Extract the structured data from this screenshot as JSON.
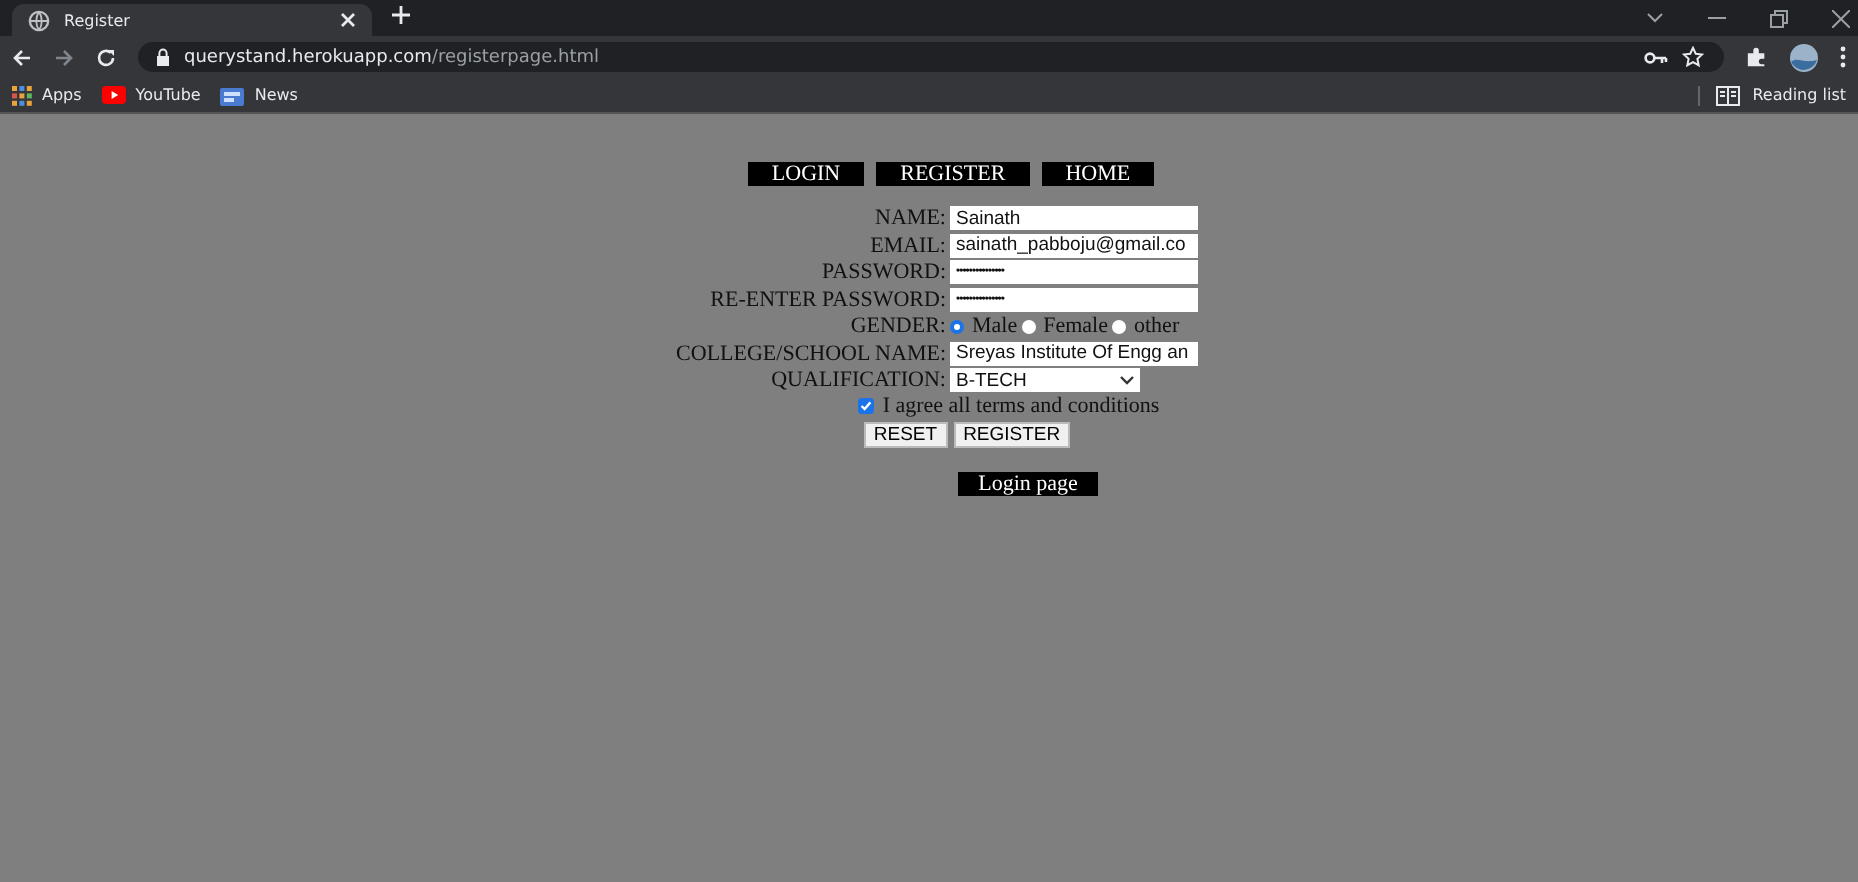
{
  "browser": {
    "tab": {
      "title": "Register"
    },
    "url": {
      "host": "querystand.herokuapp.com",
      "path": "/registerpage.html"
    },
    "bookmarks": [
      {
        "label": "Apps",
        "kind": "apps"
      },
      {
        "label": "YouTube",
        "kind": "youtube"
      },
      {
        "label": "News",
        "kind": "news"
      }
    ],
    "reading_list": "Reading list"
  },
  "nav": [
    {
      "label": "LOGIN"
    },
    {
      "label": "REGISTER"
    },
    {
      "label": "HOME"
    }
  ],
  "fields": [
    {
      "label": "NAME:",
      "kind": "text",
      "value": "Sainath"
    },
    {
      "label": "EMAIL:",
      "kind": "text",
      "value": "sainath_pabboju@gmail.co"
    },
    {
      "label": "PASSWORD:",
      "kind": "password",
      "value": "•••••••••••••••"
    },
    {
      "label": "RE-ENTER PASSWORD:",
      "kind": "password",
      "value": "•••••••••••••••"
    },
    {
      "label": "GENDER:",
      "kind": "radio",
      "options": [
        {
          "label": "Male",
          "selected": true
        },
        {
          "label": "Female",
          "selected": false
        },
        {
          "label": "other",
          "selected": false
        }
      ]
    },
    {
      "label": "COLLEGE/SCHOOL NAME:",
      "kind": "text",
      "value": "Sreyas Institute Of Engg an"
    },
    {
      "label": "QUALIFICATION:",
      "kind": "select",
      "value": "B-TECH"
    }
  ],
  "terms": {
    "label": "I agree all terms and conditions",
    "checked": true
  },
  "buttons": [
    "RESET",
    "REGISTER"
  ],
  "login_link": "Login page"
}
